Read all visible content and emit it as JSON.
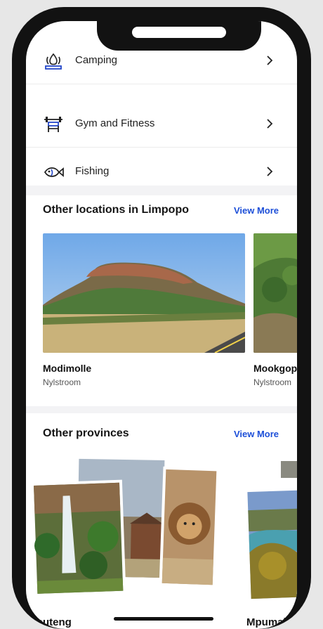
{
  "menu": {
    "items": [
      {
        "label": "Camping",
        "icon": "campfire-icon"
      },
      {
        "label": "Gym and Fitness",
        "icon": "weightlifting-icon"
      },
      {
        "label": "Fishing",
        "icon": "fish-icon"
      }
    ]
  },
  "locations": {
    "title": "Other locations in Limpopo",
    "view_more": "View More",
    "cards": [
      {
        "title": "Modimolle",
        "subtitle": "Nylstroom"
      },
      {
        "title": "Mookgopl",
        "subtitle": "Nylstroom"
      }
    ]
  },
  "provinces": {
    "title": "Other provinces",
    "view_more": "View More",
    "cards": [
      {
        "label": "Gauteng"
      },
      {
        "label": "Mpumala"
      }
    ]
  },
  "colors": {
    "accent": "#1d4fd8",
    "icon_blue": "#2447c9"
  }
}
